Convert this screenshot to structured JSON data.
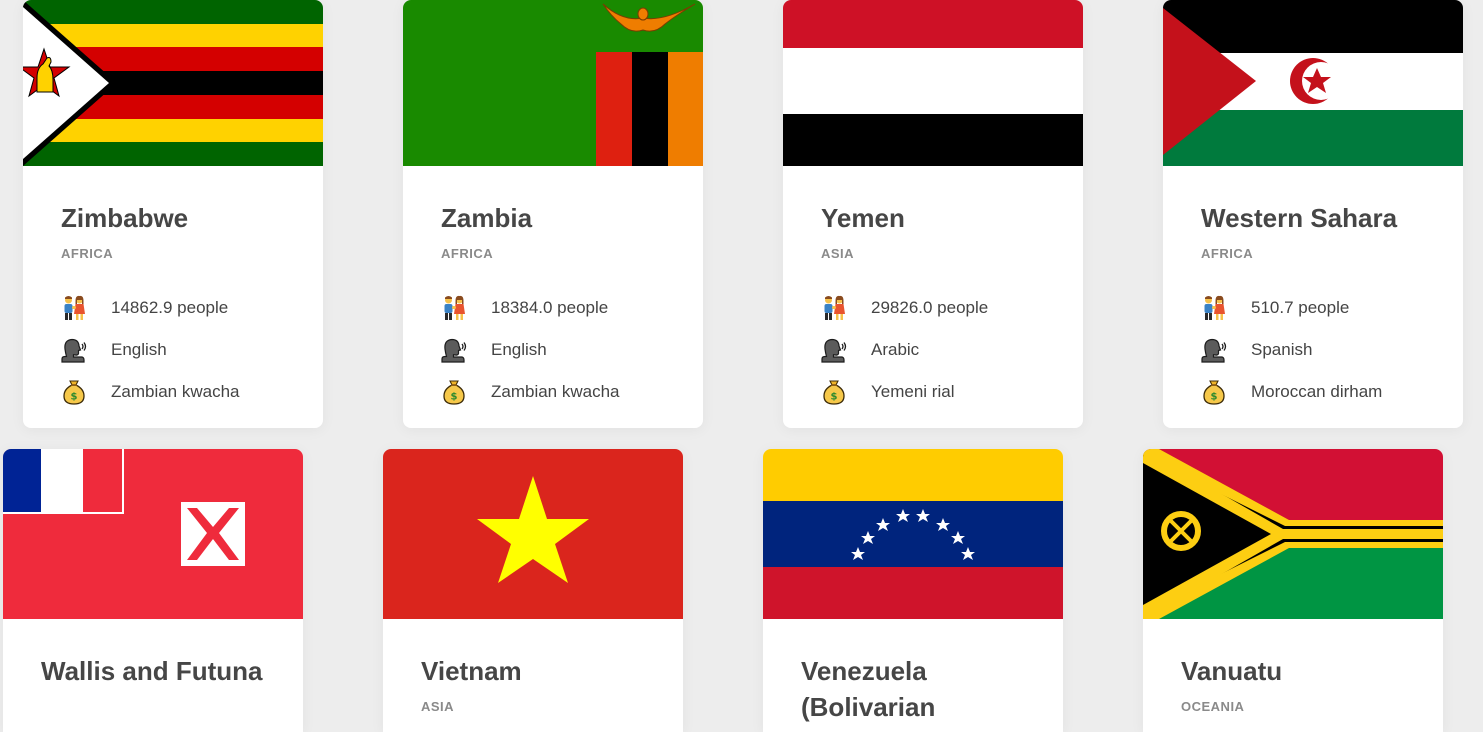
{
  "cards": [
    {
      "name": "Zimbabwe",
      "region": "AFRICA",
      "population": "14862.9 people",
      "language": "English",
      "currency": "Zambian kwacha",
      "flag": "zimbabwe-flag"
    },
    {
      "name": "Zambia",
      "region": "AFRICA",
      "population": "18384.0 people",
      "language": "English",
      "currency": "Zambian kwacha",
      "flag": "zambia-flag"
    },
    {
      "name": "Yemen",
      "region": "ASIA",
      "population": "29826.0 people",
      "language": "Arabic",
      "currency": "Yemeni rial",
      "flag": "yemen-flag"
    },
    {
      "name": "Western Sahara",
      "region": "AFRICA",
      "population": "510.7 people",
      "language": "Spanish",
      "currency": "Moroccan dirham",
      "flag": "western-sahara-flag"
    },
    {
      "name": "Wallis and Futuna",
      "flag": "wallis-and-futuna-flag"
    },
    {
      "name": "Vietnam",
      "region": "ASIA",
      "flag": "vietnam-flag"
    },
    {
      "name": "Venezuela (Bolivarian Republic of)",
      "flag": "venezuela-flag"
    },
    {
      "name": "Vanuatu",
      "region": "OCEANIA",
      "flag": "vanuatu-flag"
    }
  ],
  "icons": {
    "population": "people-holding-hands-icon",
    "language": "speaking-head-icon",
    "currency": "money-bag-icon"
  },
  "colors": {
    "page_background": "#ededed",
    "card_background": "#ffffff",
    "title_text": "#464646",
    "region_text": "#8a8a8a"
  }
}
